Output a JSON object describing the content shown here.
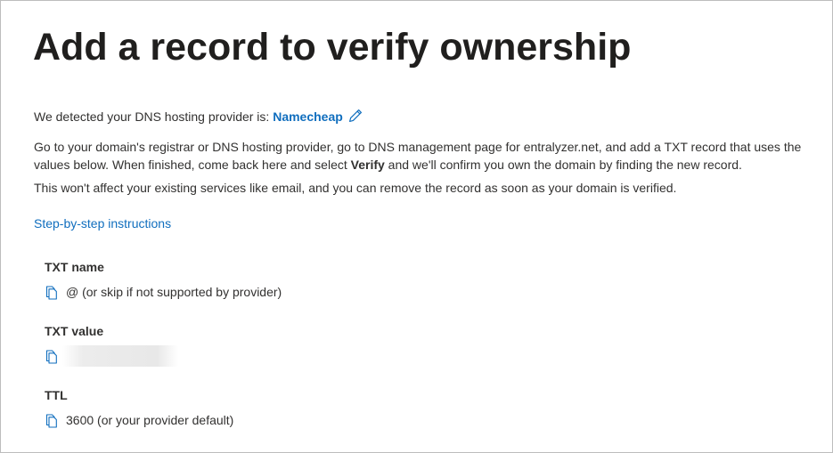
{
  "page": {
    "title": "Add a record to verify ownership"
  },
  "detection": {
    "prefix": "We detected your DNS hosting provider is: ",
    "provider": "Namecheap",
    "edit_icon": "pencil-icon"
  },
  "instructions": {
    "p1_before": "Go to your domain's registrar or DNS hosting provider, go to DNS management page for entralyzer.net, and add a TXT record that uses the values below. When finished, come back here and select ",
    "p1_bold": "Verify",
    "p1_after": " and we'll confirm you own the domain by finding the new record.",
    "p2": "This won't affect your existing services like email, and you can remove the record as soon as your domain is verified."
  },
  "step_link": "Step-by-step instructions",
  "fields": {
    "txt_name": {
      "label": "TXT name",
      "value": "@ (or skip if not supported by provider)",
      "icon": "copy-icon"
    },
    "txt_value": {
      "label": "TXT value",
      "icon": "copy-icon"
    },
    "ttl": {
      "label": "TTL",
      "value": "3600 (or your provider default)",
      "icon": "copy-icon"
    }
  },
  "colors": {
    "link": "#106ebe",
    "text": "#323130",
    "title": "#201f1e",
    "border": "#bdbdbd"
  }
}
